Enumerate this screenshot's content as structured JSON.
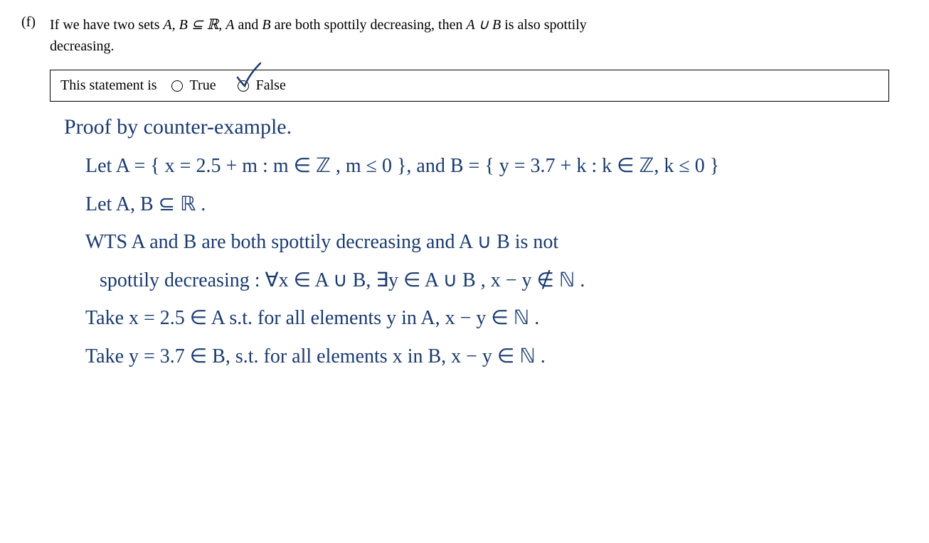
{
  "problem": {
    "label": "(f)",
    "text_part1": "If we have two sets ",
    "text_math1": "A, B ⊆ ℝ",
    "text_part2": ", ",
    "text_math2": "A",
    "text_part3": " and ",
    "text_math3": "B",
    "text_part4": " are both spottily decreasing, then ",
    "text_math4": "A ∪ B",
    "text_part5": " is also spottily",
    "text_part6": "decreasing."
  },
  "answer": {
    "prompt": "This statement is",
    "option_true": "True",
    "option_false": "False",
    "selected": "false"
  },
  "proof": {
    "line1": "Proof by counter-example.",
    "line2": "Let A = { x = 2.5 + m : m ∈ ℤ , m ≤ 0 }, and B = { y = 3.7 + k : k ∈ ℤ, k ≤ 0 }",
    "line3": "Let A, B ⊆ ℝ .",
    "line4": "WTS  A and B are both spottily decreasing and A ∪ B is not",
    "line5": "spottily decreasing : ∀x ∈ A ∪ B,  ∃y ∈ A ∪ B ,  x − y ∉ ℕ .",
    "line6": "Take x = 2.5 ∈ A s.t. for all elements y in A,  x − y ∈ ℕ .",
    "line7": "Take y = 3.7 ∈ B,  s.t. for all elements x in B,  x − y ∈ ℕ ."
  }
}
